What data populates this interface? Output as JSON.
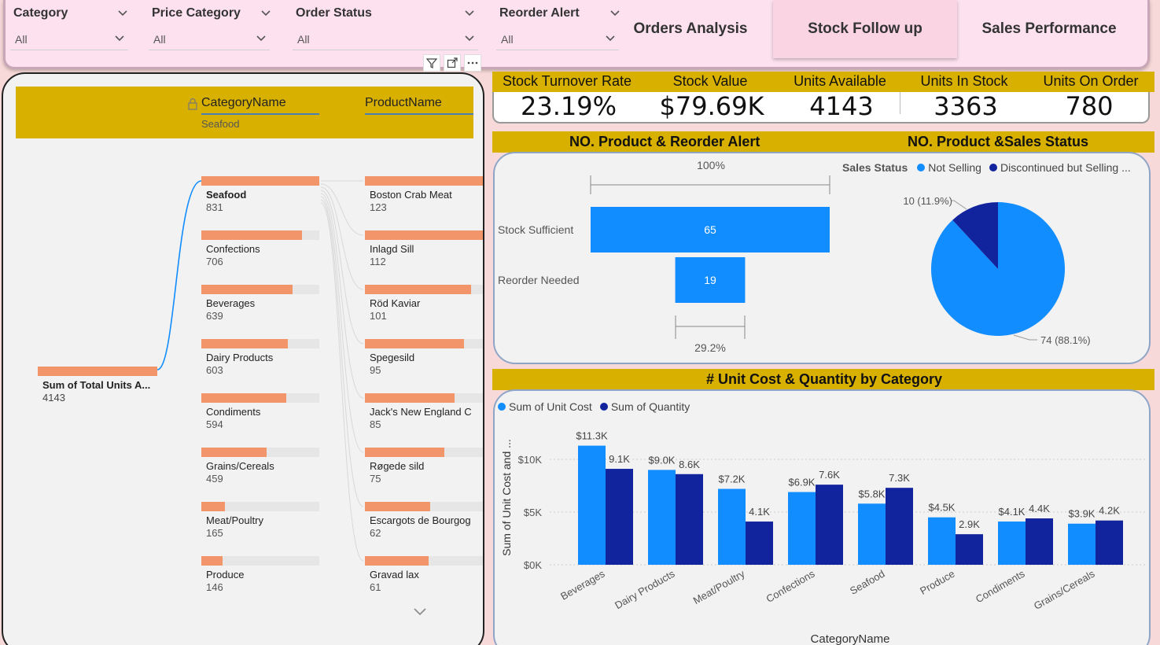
{
  "filters": [
    {
      "title": "Category",
      "value": "All"
    },
    {
      "title": "Price Category",
      "value": "All"
    },
    {
      "title": "Order Status",
      "value": "All"
    },
    {
      "title": "Reorder Alert",
      "value": "All"
    }
  ],
  "nav": {
    "orders": "Orders Analysis",
    "stock": "Stock Follow up",
    "sales": "Sales Performance"
  },
  "tree": {
    "col1": "CategoryName",
    "col1_selected": "Seafood",
    "col2": "ProductName",
    "root_label": "Sum of Total Units A...",
    "root_value": "4143",
    "categories": [
      {
        "label": "Seafood",
        "value": "831",
        "fraction": 1.0
      },
      {
        "label": "Confections",
        "value": "706",
        "fraction": 0.85
      },
      {
        "label": "Beverages",
        "value": "639",
        "fraction": 0.77
      },
      {
        "label": "Dairy Products",
        "value": "603",
        "fraction": 0.73
      },
      {
        "label": "Condiments",
        "value": "594",
        "fraction": 0.72
      },
      {
        "label": "Grains/Cereals",
        "value": "459",
        "fraction": 0.55
      },
      {
        "label": "Meat/Poultry",
        "value": "165",
        "fraction": 0.2
      },
      {
        "label": "Produce",
        "value": "146",
        "fraction": 0.18
      }
    ],
    "products": [
      {
        "label": "Boston Crab Meat",
        "value": "123",
        "fraction": 1.0
      },
      {
        "label": "Inlagd Sill",
        "value": "112",
        "fraction": 1.0
      },
      {
        "label": "Röd Kaviar",
        "value": "101",
        "fraction": 0.9
      },
      {
        "label": "Spegesild",
        "value": "95",
        "fraction": 0.84
      },
      {
        "label": "Jack's New England C",
        "value": "85",
        "fraction": 0.76
      },
      {
        "label": "Røgede sild",
        "value": "75",
        "fraction": 0.67
      },
      {
        "label": "Escargots de Bourgog",
        "value": "62",
        "fraction": 0.55
      },
      {
        "label": "Gravad lax",
        "value": "61",
        "fraction": 0.54
      }
    ]
  },
  "kpis": [
    {
      "label": "Stock Turnover Rate",
      "value": "23.19%"
    },
    {
      "label": "Stock Value",
      "value": "$79.69K"
    },
    {
      "label": "Units Available",
      "value": "4143"
    },
    {
      "label": "Units In Stock",
      "value": "3363"
    },
    {
      "label": "Units On Order",
      "value": "780"
    }
  ],
  "sections": {
    "reorder": "NO. Product & Reorder Alert",
    "sales_status": "NO. Product &Sales Status",
    "unit_cost": "# Unit Cost & Quantity by Category"
  },
  "colors": {
    "light_blue": "#118dff",
    "dark_blue": "#12239e",
    "orange": "#f2956a",
    "gold": "#d8b000"
  },
  "chart_data": [
    {
      "type": "bar",
      "orientation": "horizontal-funnel",
      "categories": [
        "Stock Sufficient",
        "Reorder Needed"
      ],
      "values": [
        65,
        19
      ],
      "top_label": "100%",
      "bottom_label": "29.2%"
    },
    {
      "type": "pie",
      "legend_title": "Sales Status",
      "labels": [
        "Not Selling",
        "Discontinued but Selling ..."
      ],
      "values": [
        74,
        10
      ],
      "data_labels": [
        "74 (88.1%)",
        "10 (11.9%)"
      ]
    },
    {
      "type": "bar",
      "categories": [
        "Beverages",
        "Dairy Products",
        "Meat/Poultry",
        "Confections",
        "Seafood",
        "Produce",
        "Condiments",
        "Grains/Cereals"
      ],
      "series": [
        {
          "name": "Sum of Unit Cost",
          "values": [
            11.3,
            9.0,
            7.2,
            6.9,
            5.8,
            4.5,
            4.1,
            3.9
          ],
          "labels": [
            "$11.3K",
            "$9.0K",
            "$7.2K",
            "$6.9K",
            "$5.8K",
            "$4.5K",
            "$4.1K",
            "$3.9K"
          ]
        },
        {
          "name": "Sum of Quantity",
          "values": [
            9.1,
            8.6,
            4.1,
            7.6,
            7.3,
            2.9,
            4.4,
            4.2
          ],
          "labels": [
            "9.1K",
            "8.6K",
            "4.1K",
            "7.6K",
            "7.3K",
            "2.9K",
            "4.4K",
            "4.2K"
          ]
        }
      ],
      "ylabel": "Sum of Unit Cost and ...",
      "xlabel": "CategoryName",
      "yticks": [
        "$0K",
        "$5K",
        "$10K"
      ],
      "ylim": [
        0,
        12
      ]
    }
  ]
}
